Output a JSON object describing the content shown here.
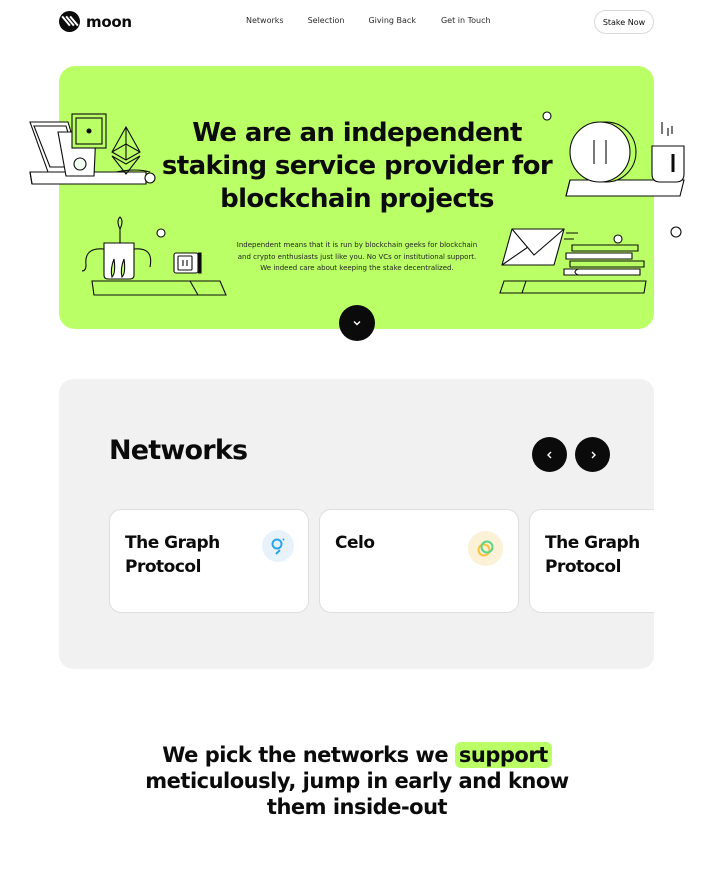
{
  "brand": {
    "name": "moon"
  },
  "nav": {
    "items": [
      "Networks",
      "Selection",
      "Giving Back",
      "Get in Touch"
    ]
  },
  "header": {
    "cta_label": "Stake Now"
  },
  "hero": {
    "title_lines": [
      "We are an independent",
      "staking service provider for",
      "blockchain projects"
    ],
    "description_lines": [
      "Independent means that it is run by blockchain geeks for blockchain",
      "and crypto enthusiasts just like you. No VCs or institutional support.",
      "We indeed care about keeping the stake decentralized."
    ],
    "background_color": "#bbff66",
    "scroll_icon": "chevron-down-icon"
  },
  "networks": {
    "title": "Networks",
    "prev_icon": "chevron-left-icon",
    "next_icon": "chevron-right-icon",
    "cards": [
      {
        "title_lines": [
          "The Graph",
          "Protocol"
        ],
        "icon": "the-graph-logo"
      },
      {
        "title_lines": [
          "Celo",
          ""
        ],
        "icon": "celo-logo"
      },
      {
        "title_lines": [
          "The Graph",
          "Protocol"
        ],
        "icon": "the-graph-logo"
      }
    ]
  },
  "tagline": {
    "line1_before": "We pick the networks we",
    "line1_highlight": "support",
    "line2": "meticulously, jump in early and know",
    "line3": "them inside-out"
  }
}
